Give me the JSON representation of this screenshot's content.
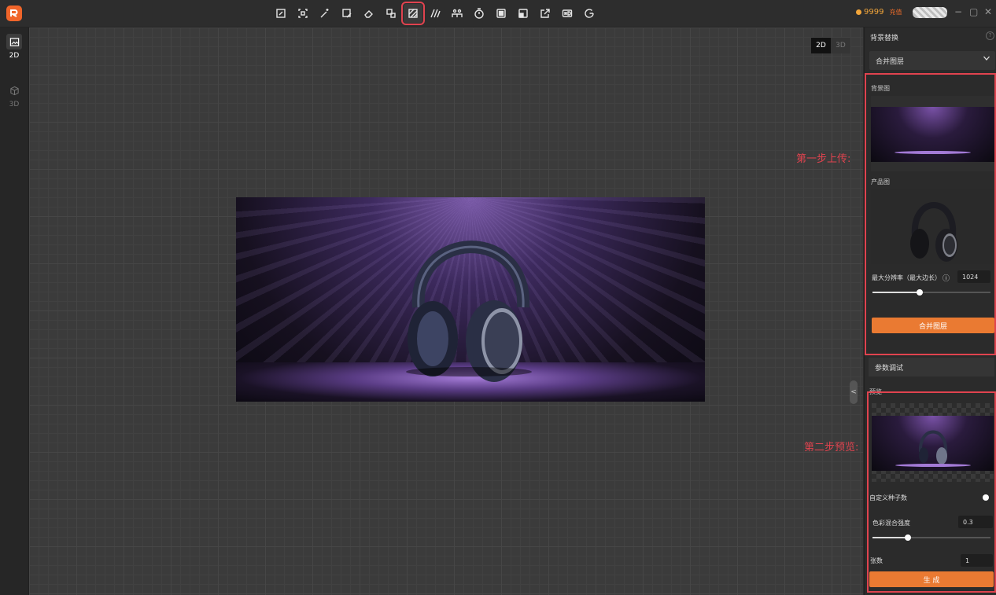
{
  "topbar": {
    "tools": [
      "crop-tool-icon",
      "select-tool-icon",
      "magic-wand-icon",
      "image-edit-icon",
      "eraser-icon",
      "replace-icon",
      "background-replace-icon",
      "stripes-icon",
      "crowd-icon",
      "timer-icon",
      "layer-front-icon",
      "layer-back-icon",
      "export-icon",
      "hd-icon",
      "google-icon"
    ],
    "active_tool": "background-replace-icon",
    "coins": "9999",
    "recharge": "充值",
    "controls": [
      "−",
      "▢",
      "✕"
    ]
  },
  "leftbar": {
    "mode_2d": "2D",
    "mode_3d": "3D"
  },
  "canvas": {
    "toggle_2d": "2D",
    "toggle_3d": "3D",
    "collapse": "<"
  },
  "annotations": {
    "step1": "第一步上传:",
    "step2": "第二步预览:"
  },
  "panel": {
    "title": "背景替换",
    "help": "?",
    "mode_select": "合并图层",
    "background_label": "背景图",
    "product_label": "产品图",
    "max_res_label": "最大分辨率（最大边长）",
    "max_res_info": "ⓘ",
    "max_res_value": "1024",
    "max_res_slider": 0.4,
    "merge_button": "合并图层",
    "params_section": "参数调试",
    "preview_label": "预览",
    "custom_seed_label": "自定义种子数",
    "color_blend_label": "色彩混合强度",
    "color_blend_value": "0.3",
    "color_blend_slider": 0.3,
    "count_label": "张数",
    "count_value": "1",
    "generate_button": "生 成"
  },
  "colors": {
    "accent": "#ea7a32",
    "highlight": "#e0434f",
    "coin": "#f2a53a"
  }
}
